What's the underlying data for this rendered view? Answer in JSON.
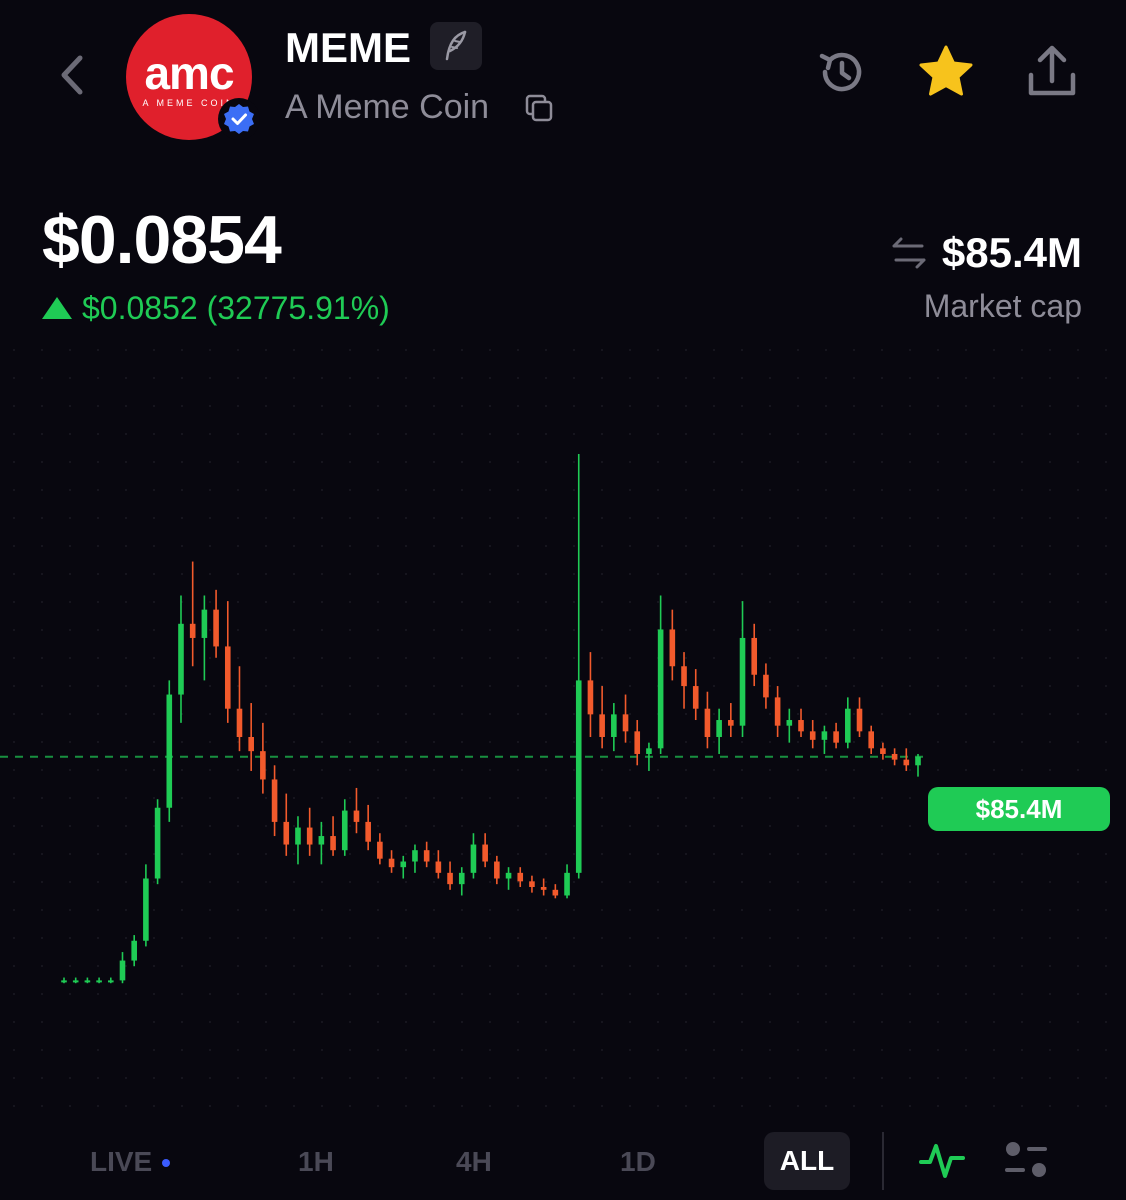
{
  "header": {
    "ticker": "MEME",
    "name": "A Meme Coin",
    "logo": {
      "word": "amc",
      "tagline": "A MEME COIN"
    },
    "icons": [
      "back-chevron-icon",
      "verified-check-icon",
      "edit-quill-icon",
      "copy-icon",
      "history-icon",
      "star-icon",
      "share-icon"
    ]
  },
  "price": {
    "current": "$0.0854",
    "change": "$0.0852 (32775.91%)",
    "direction": "up"
  },
  "market_cap": {
    "value": "$85.4M",
    "label": "Market cap"
  },
  "chart_data": {
    "type": "candlestick",
    "last_value_label": "$85.4M",
    "colors": {
      "up": "#1fcb55",
      "down": "#f25a2c",
      "background": "#08070f"
    },
    "grid": "dotted",
    "candles_approx": [
      {
        "o": 14,
        "h": 15,
        "l": 13,
        "c": 14
      },
      {
        "o": 14,
        "h": 15,
        "l": 13,
        "c": 14
      },
      {
        "o": 14,
        "h": 15,
        "l": 13,
        "c": 14
      },
      {
        "o": 14,
        "h": 15,
        "l": 13,
        "c": 14
      },
      {
        "o": 14,
        "h": 15,
        "l": 13,
        "c": 14
      },
      {
        "o": 14,
        "h": 24,
        "l": 13,
        "c": 21
      },
      {
        "o": 21,
        "h": 30,
        "l": 19,
        "c": 28
      },
      {
        "o": 28,
        "h": 55,
        "l": 26,
        "c": 50
      },
      {
        "o": 50,
        "h": 78,
        "l": 48,
        "c": 75
      },
      {
        "o": 75,
        "h": 120,
        "l": 70,
        "c": 115
      },
      {
        "o": 115,
        "h": 150,
        "l": 105,
        "c": 140
      },
      {
        "o": 140,
        "h": 162,
        "l": 125,
        "c": 135
      },
      {
        "o": 135,
        "h": 150,
        "l": 120,
        "c": 145
      },
      {
        "o": 145,
        "h": 152,
        "l": 128,
        "c": 132
      },
      {
        "o": 132,
        "h": 148,
        "l": 105,
        "c": 110
      },
      {
        "o": 110,
        "h": 125,
        "l": 95,
        "c": 100
      },
      {
        "o": 100,
        "h": 112,
        "l": 88,
        "c": 95
      },
      {
        "o": 95,
        "h": 105,
        "l": 80,
        "c": 85
      },
      {
        "o": 85,
        "h": 90,
        "l": 65,
        "c": 70
      },
      {
        "o": 70,
        "h": 80,
        "l": 58,
        "c": 62
      },
      {
        "o": 62,
        "h": 72,
        "l": 55,
        "c": 68
      },
      {
        "o": 68,
        "h": 75,
        "l": 58,
        "c": 62
      },
      {
        "o": 62,
        "h": 70,
        "l": 55,
        "c": 65
      },
      {
        "o": 65,
        "h": 72,
        "l": 58,
        "c": 60
      },
      {
        "o": 60,
        "h": 78,
        "l": 58,
        "c": 74
      },
      {
        "o": 74,
        "h": 82,
        "l": 66,
        "c": 70
      },
      {
        "o": 70,
        "h": 76,
        "l": 60,
        "c": 63
      },
      {
        "o": 63,
        "h": 66,
        "l": 55,
        "c": 57
      },
      {
        "o": 57,
        "h": 60,
        "l": 52,
        "c": 54
      },
      {
        "o": 54,
        "h": 58,
        "l": 50,
        "c": 56
      },
      {
        "o": 56,
        "h": 62,
        "l": 52,
        "c": 60
      },
      {
        "o": 60,
        "h": 63,
        "l": 54,
        "c": 56
      },
      {
        "o": 56,
        "h": 60,
        "l": 50,
        "c": 52
      },
      {
        "o": 52,
        "h": 56,
        "l": 46,
        "c": 48
      },
      {
        "o": 48,
        "h": 54,
        "l": 44,
        "c": 52
      },
      {
        "o": 52,
        "h": 66,
        "l": 50,
        "c": 62
      },
      {
        "o": 62,
        "h": 66,
        "l": 54,
        "c": 56
      },
      {
        "o": 56,
        "h": 58,
        "l": 48,
        "c": 50
      },
      {
        "o": 50,
        "h": 54,
        "l": 46,
        "c": 52
      },
      {
        "o": 52,
        "h": 54,
        "l": 47,
        "c": 49
      },
      {
        "o": 49,
        "h": 51,
        "l": 45,
        "c": 47
      },
      {
        "o": 47,
        "h": 50,
        "l": 44,
        "c": 46
      },
      {
        "o": 46,
        "h": 48,
        "l": 43,
        "c": 44
      },
      {
        "o": 44,
        "h": 55,
        "l": 43,
        "c": 52
      },
      {
        "o": 52,
        "h": 200,
        "l": 50,
        "c": 120
      },
      {
        "o": 120,
        "h": 130,
        "l": 100,
        "c": 108
      },
      {
        "o": 108,
        "h": 118,
        "l": 96,
        "c": 100
      },
      {
        "o": 100,
        "h": 112,
        "l": 95,
        "c": 108
      },
      {
        "o": 108,
        "h": 115,
        "l": 98,
        "c": 102
      },
      {
        "o": 102,
        "h": 106,
        "l": 90,
        "c": 94
      },
      {
        "o": 94,
        "h": 98,
        "l": 88,
        "c": 96
      },
      {
        "o": 96,
        "h": 150,
        "l": 94,
        "c": 138
      },
      {
        "o": 138,
        "h": 145,
        "l": 120,
        "c": 125
      },
      {
        "o": 125,
        "h": 130,
        "l": 110,
        "c": 118
      },
      {
        "o": 118,
        "h": 124,
        "l": 106,
        "c": 110
      },
      {
        "o": 110,
        "h": 116,
        "l": 96,
        "c": 100
      },
      {
        "o": 100,
        "h": 110,
        "l": 94,
        "c": 106
      },
      {
        "o": 106,
        "h": 112,
        "l": 100,
        "c": 104
      },
      {
        "o": 104,
        "h": 148,
        "l": 100,
        "c": 135
      },
      {
        "o": 135,
        "h": 140,
        "l": 118,
        "c": 122
      },
      {
        "o": 122,
        "h": 126,
        "l": 110,
        "c": 114
      },
      {
        "o": 114,
        "h": 118,
        "l": 100,
        "c": 104
      },
      {
        "o": 104,
        "h": 110,
        "l": 98,
        "c": 106
      },
      {
        "o": 106,
        "h": 110,
        "l": 100,
        "c": 102
      },
      {
        "o": 102,
        "h": 106,
        "l": 96,
        "c": 99
      },
      {
        "o": 99,
        "h": 104,
        "l": 94,
        "c": 102
      },
      {
        "o": 102,
        "h": 105,
        "l": 96,
        "c": 98
      },
      {
        "o": 98,
        "h": 114,
        "l": 96,
        "c": 110
      },
      {
        "o": 110,
        "h": 114,
        "l": 100,
        "c": 102
      },
      {
        "o": 102,
        "h": 104,
        "l": 94,
        "c": 96
      },
      {
        "o": 96,
        "h": 98,
        "l": 92,
        "c": 94
      },
      {
        "o": 94,
        "h": 96,
        "l": 90,
        "c": 92
      },
      {
        "o": 92,
        "h": 96,
        "l": 88,
        "c": 90
      },
      {
        "o": 90,
        "h": 94,
        "l": 86,
        "c": 93
      }
    ]
  },
  "timeframes": {
    "live": "LIVE",
    "h1": "1H",
    "h4": "4H",
    "d1": "1D",
    "all": "ALL",
    "selected": "ALL"
  }
}
